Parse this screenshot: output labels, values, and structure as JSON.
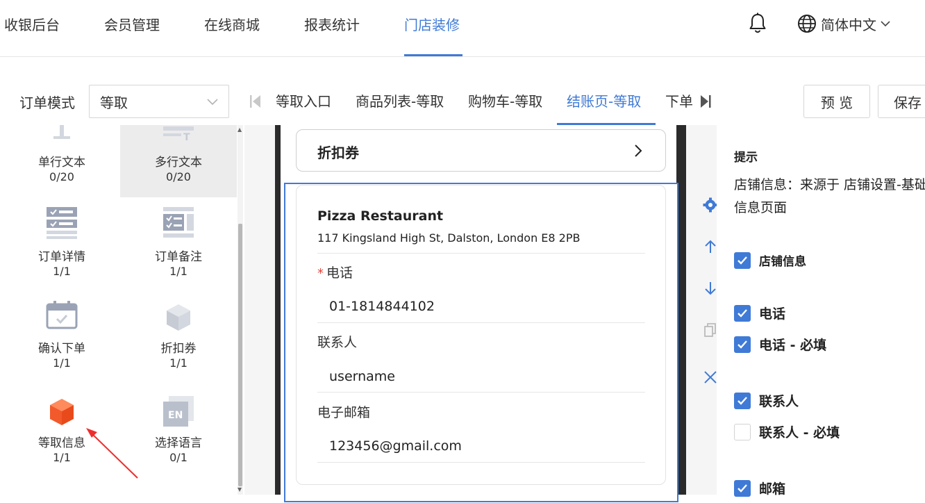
{
  "topnav": {
    "items": [
      {
        "label": "收银后台",
        "active": false
      },
      {
        "label": "会员管理",
        "active": false
      },
      {
        "label": "在线商城",
        "active": false
      },
      {
        "label": "报表统计",
        "active": false
      },
      {
        "label": "门店装修",
        "active": true
      }
    ],
    "bell_icon": "bell-icon",
    "globe_icon": "globe-icon",
    "language": "简体中文"
  },
  "toolbar": {
    "mode_label": "订单模式",
    "mode_value": "等取",
    "tabs": [
      {
        "label": "等取入口",
        "active": false
      },
      {
        "label": "商品列表-等取",
        "active": false
      },
      {
        "label": "购物车-等取",
        "active": false
      },
      {
        "label": "结账页-等取",
        "active": true
      },
      {
        "label": "下单",
        "active": false
      }
    ],
    "preview_label": "预 览",
    "save_label": "保存"
  },
  "palette": {
    "components": [
      {
        "label": "单行文本",
        "count": "0/20",
        "icon": "text-input-icon"
      },
      {
        "label": "多行文本",
        "count": "0/20",
        "icon": "textarea-icon",
        "selected": true
      },
      {
        "label": "订单详情",
        "count": "1/1",
        "icon": "order-detail-icon"
      },
      {
        "label": "订单备注",
        "count": "1/1",
        "icon": "order-note-icon"
      },
      {
        "label": "确认下单",
        "count": "1/1",
        "icon": "calendar-check-icon"
      },
      {
        "label": "折扣券",
        "count": "1/1",
        "icon": "cube-icon"
      },
      {
        "label": "等取信息",
        "count": "1/1",
        "icon": "cube-orange-icon"
      },
      {
        "label": "选择语言",
        "count": "0/1",
        "icon": "language-en-icon"
      }
    ]
  },
  "canvas": {
    "coupon_title": "折扣券",
    "store_name": "Pizza Restaurant",
    "store_address": "117 Kingsland High St, Dalston, London E8 2PB",
    "fields": [
      {
        "label": "电话",
        "required": true,
        "value": "01-1814844102"
      },
      {
        "label": "联系人",
        "required": false,
        "value": "username"
      },
      {
        "label": "电子邮箱",
        "required": false,
        "value": "123456@gmail.com"
      }
    ],
    "required_mark": "*"
  },
  "props": {
    "hint_title": "提示",
    "hint_text": "店铺信息：来源于 店铺设置-基础信息页面",
    "checkboxes": [
      {
        "label": "店铺信息",
        "checked": true
      },
      {
        "label": "电话",
        "checked": true
      },
      {
        "label": "电话 - 必填",
        "checked": true
      },
      {
        "label": "联系人",
        "checked": true
      },
      {
        "label": "联系人 - 必填",
        "checked": false
      },
      {
        "label": "邮箱",
        "checked": true
      }
    ]
  },
  "colors": {
    "accent": "#3f7ad6",
    "required": "#e0443a",
    "icon_gray": "#9aa3b5",
    "icon_orange": "#f25a2c"
  }
}
